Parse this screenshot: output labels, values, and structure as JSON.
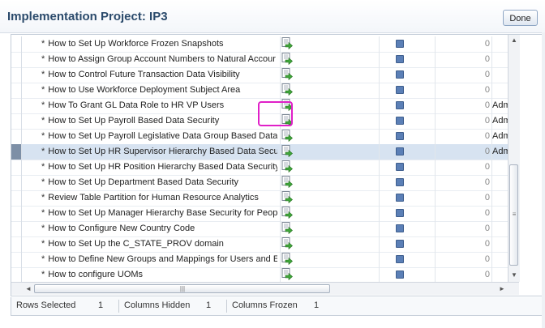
{
  "header": {
    "title": "Implementation Project: IP3",
    "done_label": "Done"
  },
  "table": {
    "rows": [
      {
        "name": "How to Set Up Workforce Frozen Snapshots",
        "count": "0",
        "extra": ""
      },
      {
        "name": "How to Assign Group Account Numbers to Natural Accour",
        "count": "0",
        "extra": ""
      },
      {
        "name": "How to Control Future Transaction Data Visibility",
        "count": "0",
        "extra": ""
      },
      {
        "name": "How to Use Workforce Deployment Subject Area",
        "count": "0",
        "extra": ""
      },
      {
        "name": "How To Grant GL Data Role to HR VP Users",
        "count": "0",
        "extra": "Adm"
      },
      {
        "name": "How to Set Up Payroll Based Data Security",
        "count": "0",
        "extra": "Adm"
      },
      {
        "name": "How to Set Up Payroll Legislative Data Group Based Data",
        "count": "0",
        "extra": "Adm"
      },
      {
        "name": "How to Set Up HR Supervisor Hierarchy Based Data Secu",
        "count": "0",
        "extra": "Adm"
      },
      {
        "name": "How to Set Up HR Position Hierarchy Based Data Security",
        "count": "0",
        "extra": ""
      },
      {
        "name": "How to Set Up Department Based Data Security",
        "count": "0",
        "extra": ""
      },
      {
        "name": "Review Table Partition for Human Resource Analytics",
        "count": "0",
        "extra": ""
      },
      {
        "name": "How to Set Up Manager Hierarchy Base Security for Peop",
        "count": "0",
        "extra": ""
      },
      {
        "name": "How to Configure New Country Code",
        "count": "0",
        "extra": ""
      },
      {
        "name": "How to Set Up the C_STATE_PROV domain",
        "count": "0",
        "extra": ""
      },
      {
        "name": "How to Define New Groups and Mappings for Users and E",
        "count": "0",
        "extra": ""
      },
      {
        "name": "How to configure UOMs",
        "count": "0",
        "extra": ""
      }
    ],
    "selected_row": 7,
    "row_marker": "*"
  },
  "footer": {
    "rows_selected_label": "Rows Selected",
    "rows_selected_value": "1",
    "columns_hidden_label": "Columns Hidden",
    "columns_hidden_value": "1",
    "columns_frozen_label": "Columns Frozen",
    "columns_frozen_value": "1"
  },
  "scrollbar_glyphs": {
    "up": "▲",
    "down": "▼",
    "left": "◄",
    "right": "►",
    "grip_v": "≡",
    "grip_h": "|||"
  },
  "icons": {
    "task": "go-to-task-icon",
    "status": "status-square-icon"
  },
  "colors": {
    "title": "#2a4a6b",
    "selected_row": "#d7e3f1",
    "status_square": "#5b7fb6",
    "highlight": "#e020c8"
  }
}
